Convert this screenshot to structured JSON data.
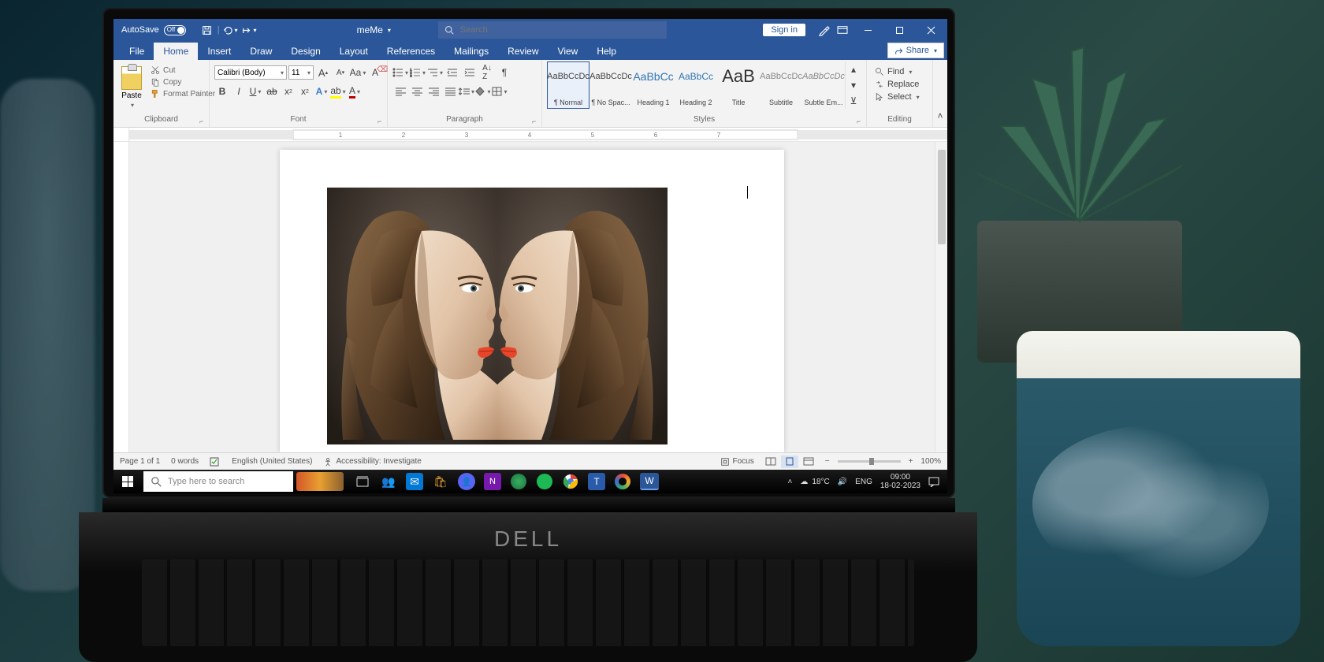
{
  "titlebar": {
    "autosave_label": "AutoSave",
    "autosave_state": "Off",
    "doc_name": "meMe",
    "search_placeholder": "Search",
    "signin": "Sign in"
  },
  "tabs": {
    "items": [
      "File",
      "Home",
      "Insert",
      "Draw",
      "Design",
      "Layout",
      "References",
      "Mailings",
      "Review",
      "View",
      "Help"
    ],
    "active": "Home",
    "share": "Share"
  },
  "ribbon": {
    "clipboard": {
      "label": "Clipboard",
      "paste": "Paste",
      "cut": "Cut",
      "copy": "Copy",
      "format_painter": "Format Painter"
    },
    "font": {
      "label": "Font",
      "name": "Calibri (Body)",
      "size": "11"
    },
    "paragraph": {
      "label": "Paragraph"
    },
    "styles": {
      "label": "Styles",
      "items": [
        {
          "preview": "AaBbCcDc",
          "name": "¶ Normal"
        },
        {
          "preview": "AaBbCcDc",
          "name": "¶ No Spac..."
        },
        {
          "preview": "AaBbCc",
          "name": "Heading 1"
        },
        {
          "preview": "AaBbCc",
          "name": "Heading 2"
        },
        {
          "preview": "AaB",
          "name": "Title"
        },
        {
          "preview": "AaBbCcDc",
          "name": "Subtitle"
        },
        {
          "preview": "AaBbCcDc",
          "name": "Subtle Em..."
        }
      ]
    },
    "editing": {
      "label": "Editing",
      "find": "Find",
      "replace": "Replace",
      "select": "Select"
    }
  },
  "status": {
    "page": "Page 1 of 1",
    "words": "0 words",
    "language": "English (United States)",
    "accessibility": "Accessibility: Investigate",
    "focus": "Focus",
    "zoom": "100%"
  },
  "taskbar": {
    "search_placeholder": "Type here to search",
    "weather_temp": "18°C",
    "lang": "ENG",
    "time": "09:00",
    "date": "18-02-2023"
  },
  "laptop_brand": "DELL"
}
